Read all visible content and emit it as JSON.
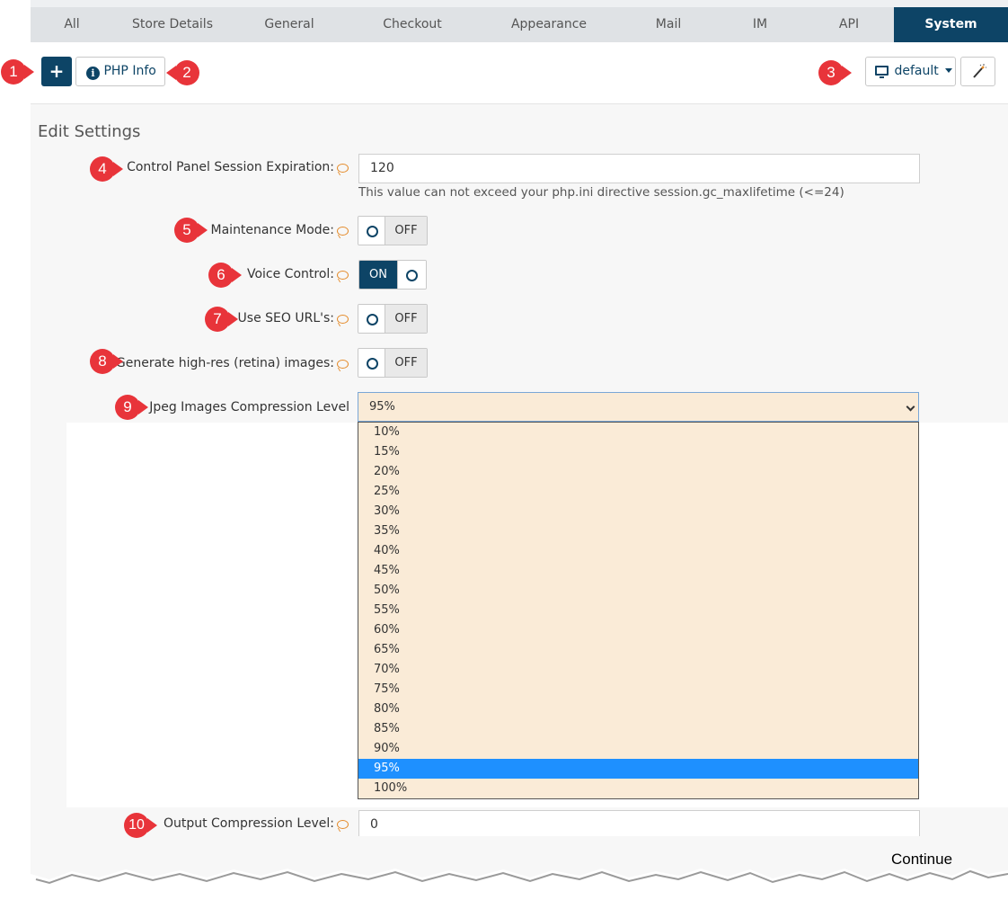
{
  "tabs": [
    "All",
    "Store Details",
    "General",
    "Checkout",
    "Appearance",
    "Mail",
    "IM",
    "API",
    "System"
  ],
  "active_tab": "System",
  "toolbar": {
    "add_label": "+",
    "php_info_label": "PHP Info",
    "template_label": "default"
  },
  "panel": {
    "title": "Edit Settings"
  },
  "fields": {
    "session_expiration": {
      "label": "Control Panel Session Expiration:",
      "value": "120",
      "help": "This value can not exceed your php.ini directive session.gc_maxlifetime (<=24)"
    },
    "maintenance_mode": {
      "label": "Maintenance Mode:",
      "state": "OFF"
    },
    "voice_control": {
      "label": "Voice Control:",
      "state": "ON"
    },
    "seo_urls": {
      "label": "Use SEO URL's:",
      "state": "OFF"
    },
    "retina_images": {
      "label": "Generate high-res (retina) images:",
      "state": "OFF"
    },
    "jpeg_compression": {
      "label": "Jpeg Images Compression Level",
      "value": "95%",
      "options": [
        "10%",
        "15%",
        "20%",
        "25%",
        "30%",
        "35%",
        "40%",
        "45%",
        "50%",
        "55%",
        "60%",
        "65%",
        "70%",
        "75%",
        "80%",
        "85%",
        "90%",
        "95%",
        "100%"
      ],
      "selected_index": 17
    },
    "output_compression": {
      "label": "Output Compression Level:",
      "value": "0"
    }
  },
  "markers": [
    "1",
    "2",
    "3",
    "4",
    "5",
    "6",
    "7",
    "8",
    "9",
    "10"
  ],
  "footer": {
    "continue": "Continue"
  },
  "colors": {
    "primary": "#0d4466",
    "marker": "#e8343a",
    "select_bg": "#faebd7",
    "highlight": "#1e90ff",
    "help_icon": "#e48b2b"
  }
}
